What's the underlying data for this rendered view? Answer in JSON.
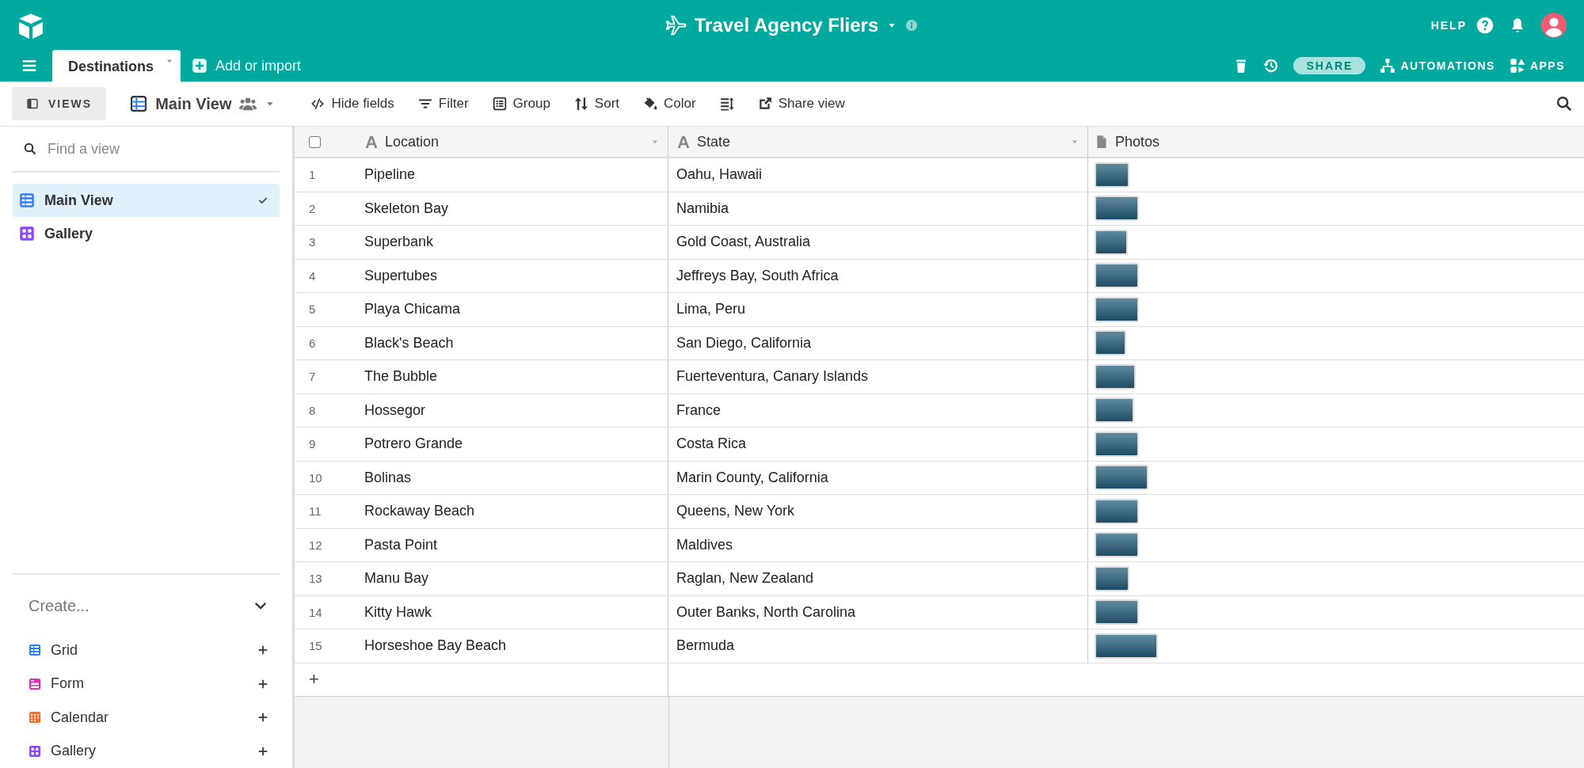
{
  "app_bar": {
    "title": "Travel Agency Fliers",
    "help": "HELP"
  },
  "tabs": [
    {
      "label": "Destinations",
      "selected": true
    }
  ],
  "add_tab": "Add or import",
  "right_actions": [
    {
      "kind": "trash"
    },
    {
      "kind": "history"
    },
    {
      "kind": "share",
      "label": "SHARE"
    },
    {
      "kind": "automations",
      "label": "AUTOMATIONS"
    },
    {
      "kind": "apps",
      "label": "APPS"
    }
  ],
  "views_button": "VIEWS",
  "current_view": "Main View",
  "toolbar": [
    {
      "kind": "hide",
      "label": "Hide fields"
    },
    {
      "kind": "filter",
      "label": "Filter"
    },
    {
      "kind": "group",
      "label": "Group"
    },
    {
      "kind": "sort",
      "label": "Sort"
    },
    {
      "kind": "color",
      "label": "Color"
    },
    {
      "kind": "height"
    },
    {
      "kind": "share",
      "label": "Share view"
    }
  ],
  "sidebar": {
    "search_placeholder": "Find a view",
    "views": [
      {
        "label": "Main View",
        "kind": "grid",
        "selected": true,
        "color": "#2d7ff9"
      },
      {
        "label": "Gallery",
        "kind": "gallery",
        "selected": false,
        "color": "#8b46ff"
      }
    ],
    "create_label": "Create...",
    "create_items": [
      {
        "label": "Grid",
        "kind": "grid",
        "color": "#2d7ff9"
      },
      {
        "label": "Form",
        "kind": "form",
        "color": "#e929ba"
      },
      {
        "label": "Calendar",
        "kind": "calendar",
        "color": "#ff6f2c"
      },
      {
        "label": "Gallery",
        "kind": "gallery",
        "color": "#8b46ff"
      }
    ]
  },
  "table": {
    "columns": [
      {
        "label": "Location",
        "kind": "text"
      },
      {
        "label": "State",
        "kind": "text"
      },
      {
        "label": "Photos",
        "kind": "attachment"
      }
    ],
    "rows": [
      {
        "n": "1",
        "location": "Pipeline",
        "state": "Oahu, Hawaii"
      },
      {
        "n": "2",
        "location": "Skeleton Bay",
        "state": "Namibia"
      },
      {
        "n": "3",
        "location": "Superbank",
        "state": "Gold Coast, Australia"
      },
      {
        "n": "4",
        "location": "Supertubes",
        "state": "Jeffreys Bay, South Africa"
      },
      {
        "n": "5",
        "location": "Playa Chicama",
        "state": "Lima, Peru"
      },
      {
        "n": "6",
        "location": "Black's Beach",
        "state": "San Diego, California"
      },
      {
        "n": "7",
        "location": "The Bubble",
        "state": "Fuerteventura, Canary Islands"
      },
      {
        "n": "8",
        "location": "Hossegor",
        "state": "France"
      },
      {
        "n": "9",
        "location": "Potrero Grande",
        "state": "Costa Rica"
      },
      {
        "n": "10",
        "location": "Bolinas",
        "state": "Marin County, California"
      },
      {
        "n": "11",
        "location": "Rockaway Beach",
        "state": "Queens, New York"
      },
      {
        "n": "12",
        "location": "Pasta Point",
        "state": "Maldives"
      },
      {
        "n": "13",
        "location": "Manu Bay",
        "state": "Raglan, New Zealand"
      },
      {
        "n": "14",
        "location": "Kitty Hawk",
        "state": "Outer Banks, North Carolina"
      },
      {
        "n": "15",
        "location": "Horseshoe Bay Beach",
        "state": "Bermuda"
      }
    ],
    "add_row": "+",
    "select_all_checked": false
  }
}
